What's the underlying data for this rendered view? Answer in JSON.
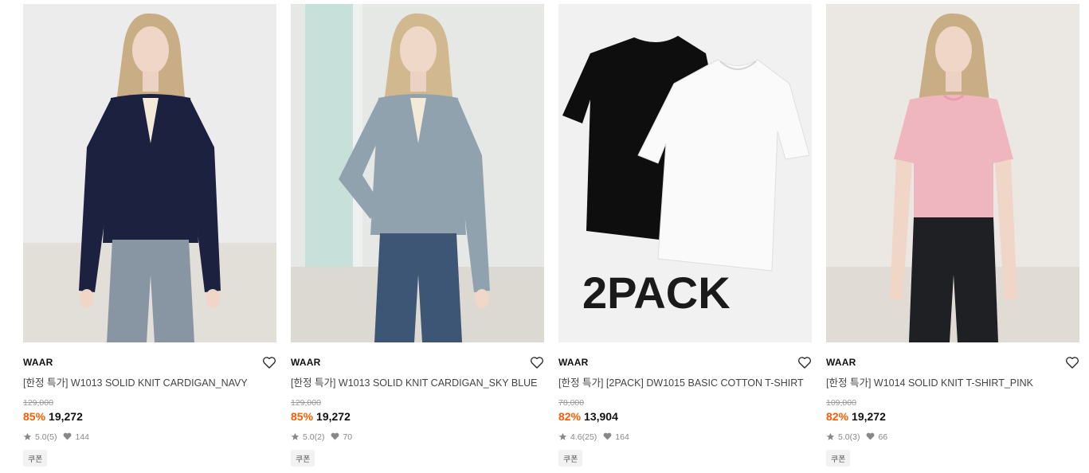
{
  "products": [
    {
      "brand": "WAAR",
      "name": "[한정 특가] W1013 SOLID KNIT CARDIGAN_NAVY",
      "original_price": "129,000",
      "discount": "85%",
      "price": "19,272",
      "rating": "5.0",
      "reviews": "(5)",
      "likes": "144",
      "badge": "쿠폰",
      "image": {
        "kind": "model",
        "background": "#ececec",
        "top_color": "#1d2140",
        "pants_color": "#8896a4"
      }
    },
    {
      "brand": "WAAR",
      "name": "[한정 특가] W1013 SOLID KNIT CARDIGAN_SKY BLUE",
      "original_price": "129,000",
      "discount": "85%",
      "price": "19,272",
      "rating": "5.0",
      "reviews": "(2)",
      "likes": "70",
      "badge": "쿠폰",
      "image": {
        "kind": "model",
        "background": "#e6e8e5",
        "top_color": "#8fa2ae",
        "pants_color": "#3e5675"
      }
    },
    {
      "brand": "WAAR",
      "name": "[한정 특가] [2PACK] DW1015 BASIC COTTON T-SHIRT",
      "original_price": "78,000",
      "discount": "82%",
      "price": "13,904",
      "rating": "4.6",
      "reviews": "(25)",
      "likes": "164",
      "badge": "쿠폰",
      "image": {
        "kind": "flatlay",
        "background": "#f1f1f1",
        "label": "2PACK"
      }
    },
    {
      "brand": "WAAR",
      "name": "[한정 특가] W1014 SOLID KNIT T-SHIRT_PINK",
      "original_price": "109,000",
      "discount": "82%",
      "price": "19,272",
      "rating": "5.0",
      "reviews": "(3)",
      "likes": "66",
      "badge": "쿠폰",
      "image": {
        "kind": "model",
        "background": "#ebe8e3",
        "top_color": "#f0b6bf",
        "pants_color": "#1f2024"
      }
    }
  ],
  "icons": {
    "wishlist": "heart-outline-icon",
    "rating": "star-icon",
    "likes": "heart-filled-icon"
  },
  "colors": {
    "discount": "#ff5a00",
    "text": "#111111",
    "muted": "#888888"
  }
}
